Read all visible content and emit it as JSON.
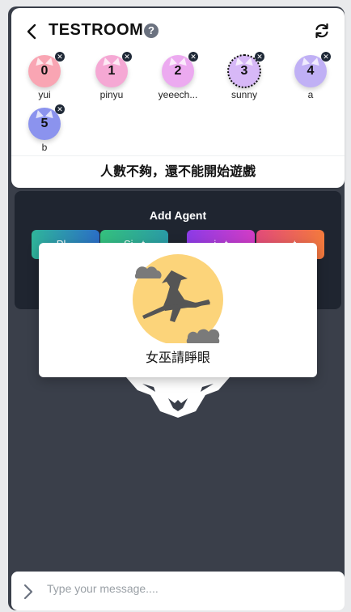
{
  "room": {
    "title": "TESTROOM",
    "help_glyph": "?"
  },
  "players": [
    {
      "number": "0",
      "name": "yui",
      "color": "#f9a5b3",
      "kick_glyph": "✕"
    },
    {
      "number": "1",
      "name": "pinyu",
      "color": "#f5a8d4",
      "kick_glyph": "✕"
    },
    {
      "number": "2",
      "name": "yeeech...",
      "color": "#ecaaf0",
      "kick_glyph": "✕"
    },
    {
      "number": "3",
      "name": "sunny",
      "color": "#d7b8f7",
      "kick_glyph": "✕"
    },
    {
      "number": "4",
      "name": "a",
      "color": "#c0b0f5",
      "kick_glyph": "✕"
    },
    {
      "number": "5",
      "name": "b",
      "color": "#8b93ee",
      "kick_glyph": "✕"
    }
  ],
  "status_text": "人數不夠，還不能開始遊戲",
  "agent_panel": {
    "title": "Add Agent",
    "buttons": [
      {
        "label": "Pl...",
        "colors": [
          "#2fb59a",
          "#2b6ec6"
        ]
      },
      {
        "label": "Si...t",
        "colors": [
          "#34c07d",
          "#2a9aa6"
        ]
      },
      {
        "label": "i...t",
        "colors": [
          "#8b3be6",
          "#d23cc4"
        ]
      },
      {
        "label": "...t",
        "colors": [
          "#e14b7a",
          "#f37a3c"
        ]
      }
    ]
  },
  "modal": {
    "text": "女巫請睜眼",
    "icon": "witch-icon"
  },
  "chat": {
    "placeholder": "Type your message...."
  },
  "colors": {
    "frame": "#3a3f4a",
    "panel": "#1f2530",
    "moon": "#fcd47a"
  }
}
